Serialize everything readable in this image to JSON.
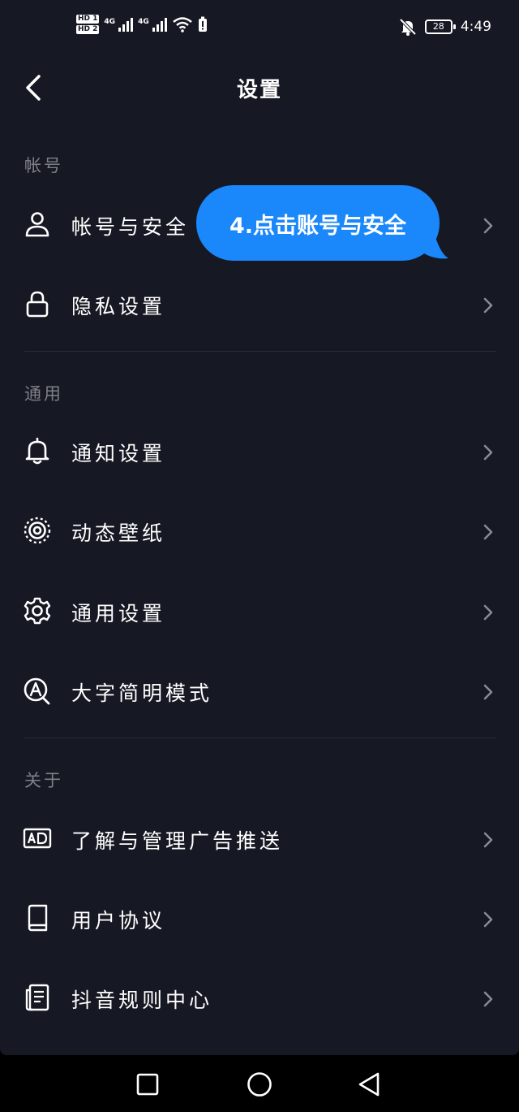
{
  "status_bar": {
    "sim1": "HD 1",
    "sim2": "HD 2",
    "network1": "4G",
    "network2": "4G",
    "battery_level": "28",
    "time": "4:49"
  },
  "header": {
    "title": "设置"
  },
  "sections": [
    {
      "label": "帐号",
      "items": [
        {
          "label": "帐号与安全",
          "icon": "user-icon"
        },
        {
          "label": "隐私设置",
          "icon": "lock-icon"
        }
      ]
    },
    {
      "label": "通用",
      "items": [
        {
          "label": "通知设置",
          "icon": "bell-icon"
        },
        {
          "label": "动态壁纸",
          "icon": "wallpaper-icon"
        },
        {
          "label": "通用设置",
          "icon": "gear-icon"
        },
        {
          "label": "大字简明模式",
          "icon": "large-font-icon"
        }
      ]
    },
    {
      "label": "关于",
      "items": [
        {
          "label": "了解与管理广告推送",
          "icon": "ad-icon"
        },
        {
          "label": "用户协议",
          "icon": "book-icon"
        },
        {
          "label": "抖音规则中心",
          "icon": "document-icon"
        }
      ]
    }
  ],
  "tooltip": {
    "text": "4.点击账号与安全",
    "color": "#1a87fa"
  },
  "navigation_bar": {
    "buttons": [
      "recents-icon",
      "home-icon",
      "back-triangle-icon"
    ]
  },
  "colors": {
    "background": "#161823",
    "section_label": "#7f8088",
    "divider": "#2a2c36"
  }
}
